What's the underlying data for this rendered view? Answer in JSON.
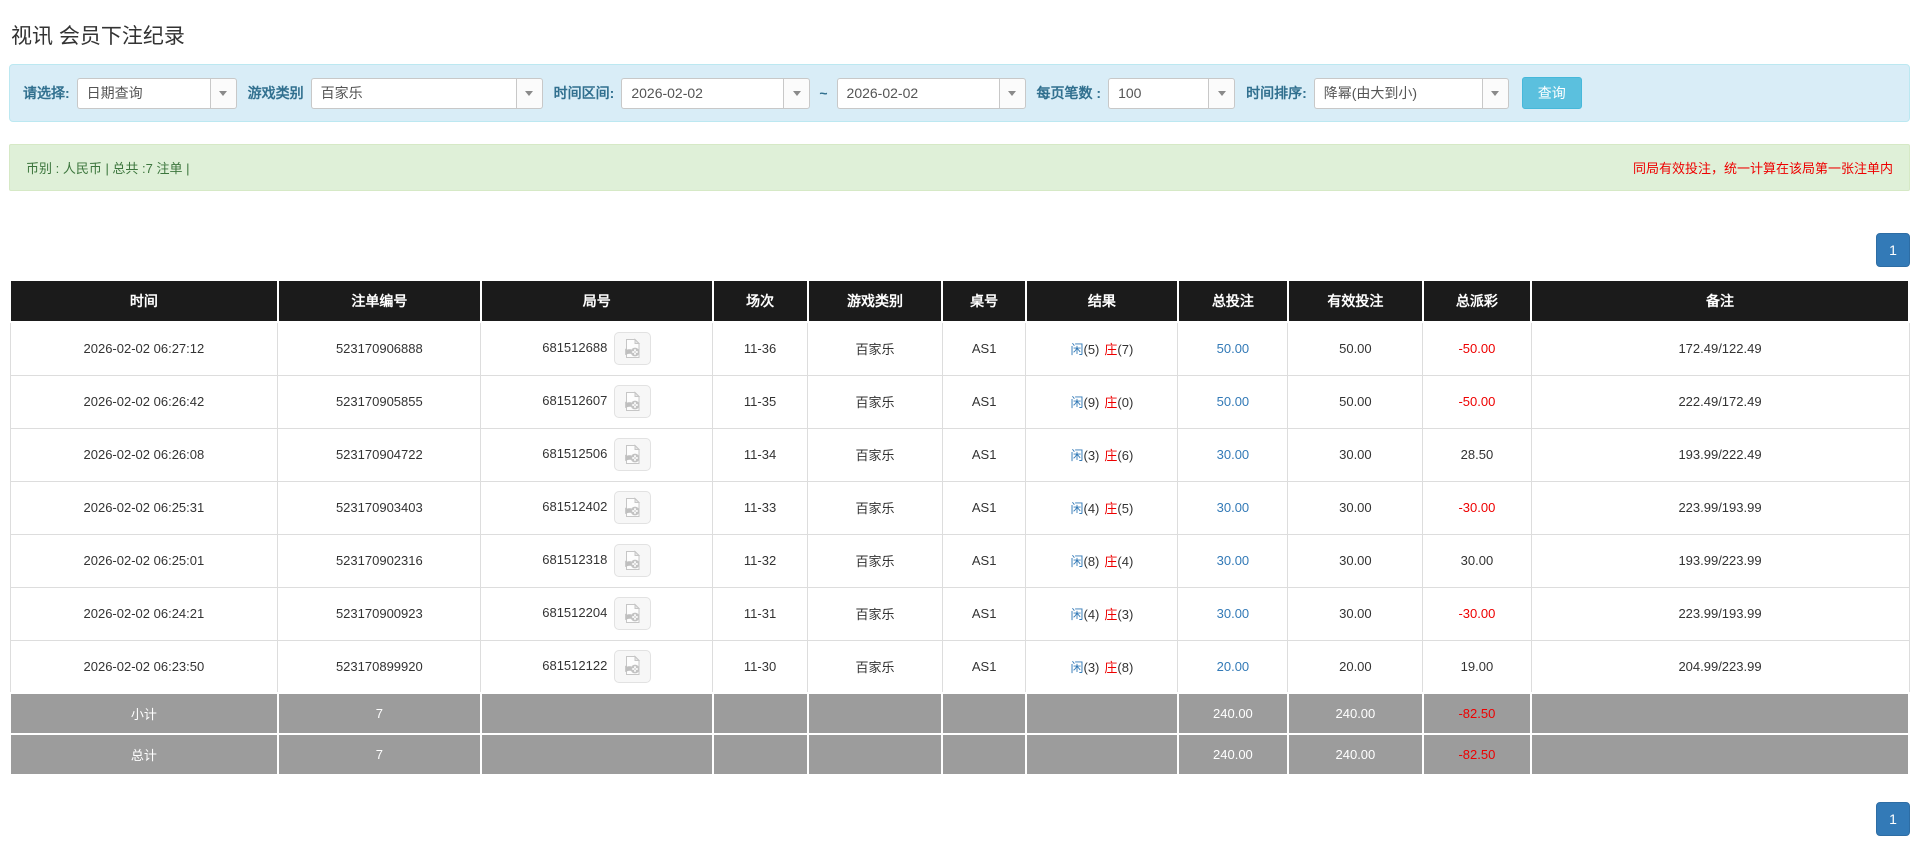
{
  "page": {
    "title": "视讯 会员下注纪录"
  },
  "filters": {
    "select": {
      "label": "请选择:",
      "value": "日期查询"
    },
    "game_type": {
      "label": "游戏类别",
      "value": "百家乐"
    },
    "time_range": {
      "label": "时间区间:",
      "from": "2026-02-02",
      "separator": "~",
      "to": "2026-02-02"
    },
    "page_size": {
      "label": "每页笔数 :",
      "value": "100"
    },
    "sort": {
      "label": "时间排序:",
      "value": "降幂(由大到小)"
    },
    "search_button": "查询"
  },
  "summary": {
    "currency_info": "币别 : 人民币 | 总共 :7 注单 |",
    "notice": "同局有效投注，统一计算在该局第一张注单内"
  },
  "pagination": {
    "page": "1"
  },
  "table": {
    "headers": [
      "时间",
      "注单编号",
      "局号",
      "场次",
      "游戏类别",
      "桌号",
      "结果",
      "总投注",
      "有效投注",
      "总派彩",
      "备注"
    ],
    "rows": [
      {
        "time": "2026-02-02 06:27:12",
        "bet_id": "523170906888",
        "round_id": "681512688",
        "session": "11-36",
        "game": "百家乐",
        "table_no": "AS1",
        "result": {
          "player_label": "闲",
          "player_value": "(5)",
          "banker_label": "庄",
          "banker_value": "(7)"
        },
        "total_bet": "50.00",
        "valid_bet": "50.00",
        "payout": "-50.00",
        "note": "172.49/122.49"
      },
      {
        "time": "2026-02-02 06:26:42",
        "bet_id": "523170905855",
        "round_id": "681512607",
        "session": "11-35",
        "game": "百家乐",
        "table_no": "AS1",
        "result": {
          "player_label": "闲",
          "player_value": "(9)",
          "banker_label": "庄",
          "banker_value": "(0)"
        },
        "total_bet": "50.00",
        "valid_bet": "50.00",
        "payout": "-50.00",
        "note": "222.49/172.49"
      },
      {
        "time": "2026-02-02 06:26:08",
        "bet_id": "523170904722",
        "round_id": "681512506",
        "session": "11-34",
        "game": "百家乐",
        "table_no": "AS1",
        "result": {
          "player_label": "闲",
          "player_value": "(3)",
          "banker_label": "庄",
          "banker_value": "(6)"
        },
        "total_bet": "30.00",
        "valid_bet": "30.00",
        "payout": "28.50",
        "note": "193.99/222.49"
      },
      {
        "time": "2026-02-02 06:25:31",
        "bet_id": "523170903403",
        "round_id": "681512402",
        "session": "11-33",
        "game": "百家乐",
        "table_no": "AS1",
        "result": {
          "player_label": "闲",
          "player_value": "(4)",
          "banker_label": "庄",
          "banker_value": "(5)"
        },
        "total_bet": "30.00",
        "valid_bet": "30.00",
        "payout": "-30.00",
        "note": "223.99/193.99"
      },
      {
        "time": "2026-02-02 06:25:01",
        "bet_id": "523170902316",
        "round_id": "681512318",
        "session": "11-32",
        "game": "百家乐",
        "table_no": "AS1",
        "result": {
          "player_label": "闲",
          "player_value": "(8)",
          "banker_label": "庄",
          "banker_value": "(4)"
        },
        "total_bet": "30.00",
        "valid_bet": "30.00",
        "payout": "30.00",
        "note": "193.99/223.99"
      },
      {
        "time": "2026-02-02 06:24:21",
        "bet_id": "523170900923",
        "round_id": "681512204",
        "session": "11-31",
        "game": "百家乐",
        "table_no": "AS1",
        "result": {
          "player_label": "闲",
          "player_value": "(4)",
          "banker_label": "庄",
          "banker_value": "(3)"
        },
        "total_bet": "30.00",
        "valid_bet": "30.00",
        "payout": "-30.00",
        "note": "223.99/193.99"
      },
      {
        "time": "2026-02-02 06:23:50",
        "bet_id": "523170899920",
        "round_id": "681512122",
        "session": "11-30",
        "game": "百家乐",
        "table_no": "AS1",
        "result": {
          "player_label": "闲",
          "player_value": "(3)",
          "banker_label": "庄",
          "banker_value": "(8)"
        },
        "total_bet": "20.00",
        "valid_bet": "20.00",
        "payout": "19.00",
        "note": "204.99/223.99"
      }
    ],
    "subtotal": {
      "label": "小计",
      "count": "7",
      "total_bet": "240.00",
      "valid_bet": "240.00",
      "payout": "-82.50"
    },
    "total": {
      "label": "总计",
      "count": "7",
      "total_bet": "240.00",
      "valid_bet": "240.00",
      "payout": "-82.50"
    }
  },
  "colors": {
    "link_blue": "#337ab7",
    "banker_red": "#ee0000",
    "negative_red": "#ee0000",
    "filter_bg": "#d9edf7",
    "summary_bg": "#dff0d8",
    "summary_text": "#3c763d",
    "header_bg": "#1b1b1b",
    "footer_bg": "#9c9c9c",
    "search_button_bg": "#5bc0de",
    "pagination_bg": "#337ab7"
  }
}
